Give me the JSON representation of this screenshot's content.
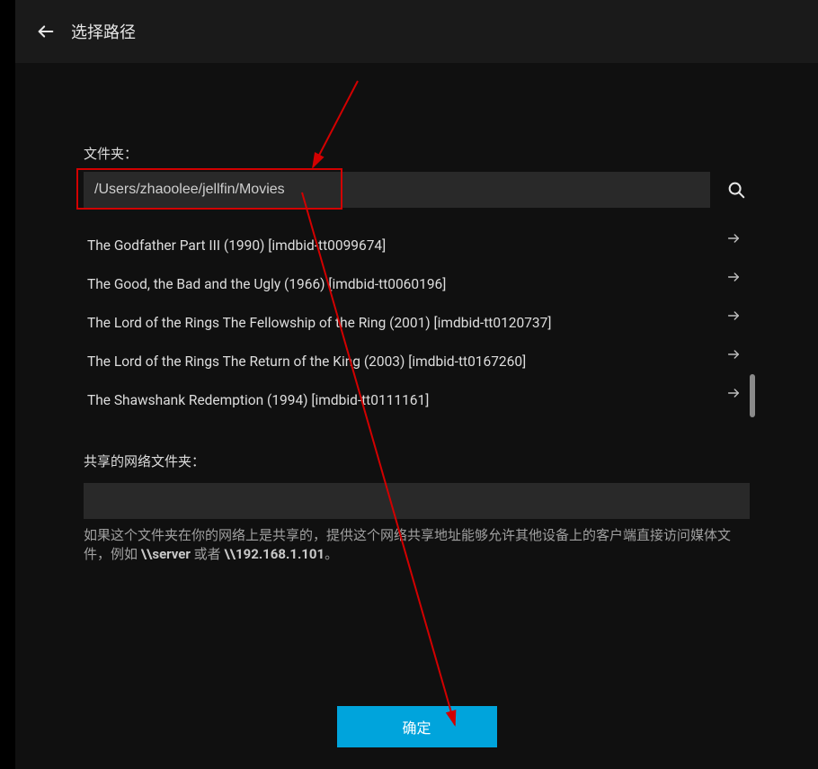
{
  "header": {
    "title": "选择路径"
  },
  "folder": {
    "label": "文件夹：",
    "path": "/Users/zhaoolee/jellfin/Movies"
  },
  "items": [
    {
      "name": "The Godfather Part III (1990) [imdbid-tt0099674]"
    },
    {
      "name": "The Good, the Bad and the Ugly (1966) [imdbid-tt0060196]"
    },
    {
      "name": "The Lord of the Rings The Fellowship of the Ring (2001) [imdbid-tt0120737]"
    },
    {
      "name": "The Lord of the Rings The Return of the King (2003) [imdbid-tt0167260]"
    },
    {
      "name": "The Shawshank Redemption (1994) [imdbid-tt0111161]"
    }
  ],
  "network": {
    "label": "共享的网络文件夹：",
    "value": "",
    "hint_pre": "如果这个文件夹在你的网络上是共享的，提供这个网络共享地址能够允许其他设备上的客户端直接访问媒体文件，例如 ",
    "example1": "\\\\server",
    "hint_mid": " 或者 ",
    "example2": "\\\\192.168.1.101",
    "hint_end": "。"
  },
  "footer": {
    "ok": "确定"
  },
  "icons": {
    "back": "arrow-left-icon",
    "search": "search-icon",
    "enter": "arrow-right-icon"
  }
}
